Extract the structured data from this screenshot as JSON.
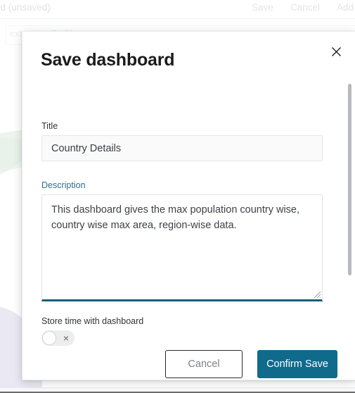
{
  "background": {
    "topbar": {
      "title": "rd (unsaved)",
      "actions": [
        "Save",
        "Cancel",
        "Add"
      ]
    },
    "subbar": {
      "text": "extension:PHP)"
    }
  },
  "modal": {
    "title": "Save dashboard",
    "close_icon": "close-icon",
    "fields": {
      "title": {
        "label": "Title",
        "value": "Country Details",
        "placeholder": ""
      },
      "description": {
        "label": "Description",
        "value": "This dashboard gives the max population country wise, country wise max area, region-wise data.",
        "placeholder": "",
        "focused": true
      },
      "store_time": {
        "label": "Store time with dashboard",
        "state": "off",
        "off_glyph": "×"
      }
    },
    "footer": {
      "cancel_label": "Cancel",
      "confirm_label": "Confirm Save"
    }
  },
  "colors": {
    "accent": "#0f6a8c",
    "focus_underline": "#1a5e78",
    "focused_label": "#2a6f8e",
    "text": "#1b1b1b",
    "muted_text": "#7d8287",
    "scrollbar_thumb": "#b6b9bc"
  }
}
